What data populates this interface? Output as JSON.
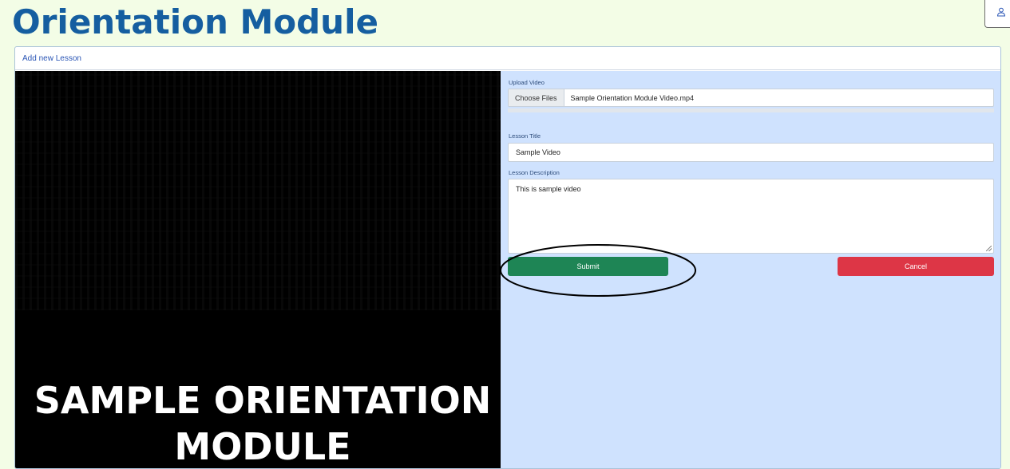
{
  "header": {
    "title": "Orientation Module",
    "user_icon": "user-icon"
  },
  "card": {
    "header_link": "Add new Lesson"
  },
  "video": {
    "caption_line1": "SAMPLE ORIENTATION",
    "caption_line2": "MODULE"
  },
  "form": {
    "upload_label": "Upload Video",
    "choose_files_label": "Choose Files",
    "file_name": "Sample Orientation Module Video.mp4",
    "title_label": "Lesson Title",
    "title_value": "Sample Video",
    "description_label": "Lesson Description",
    "description_value": "This is sample video",
    "submit_label": "Submit",
    "cancel_label": "Cancel"
  },
  "colors": {
    "title": "#155ea0",
    "page_bg": "#f3fde6",
    "form_bg": "#cfe2fe",
    "submit": "#1e8555",
    "cancel": "#dd3646"
  }
}
